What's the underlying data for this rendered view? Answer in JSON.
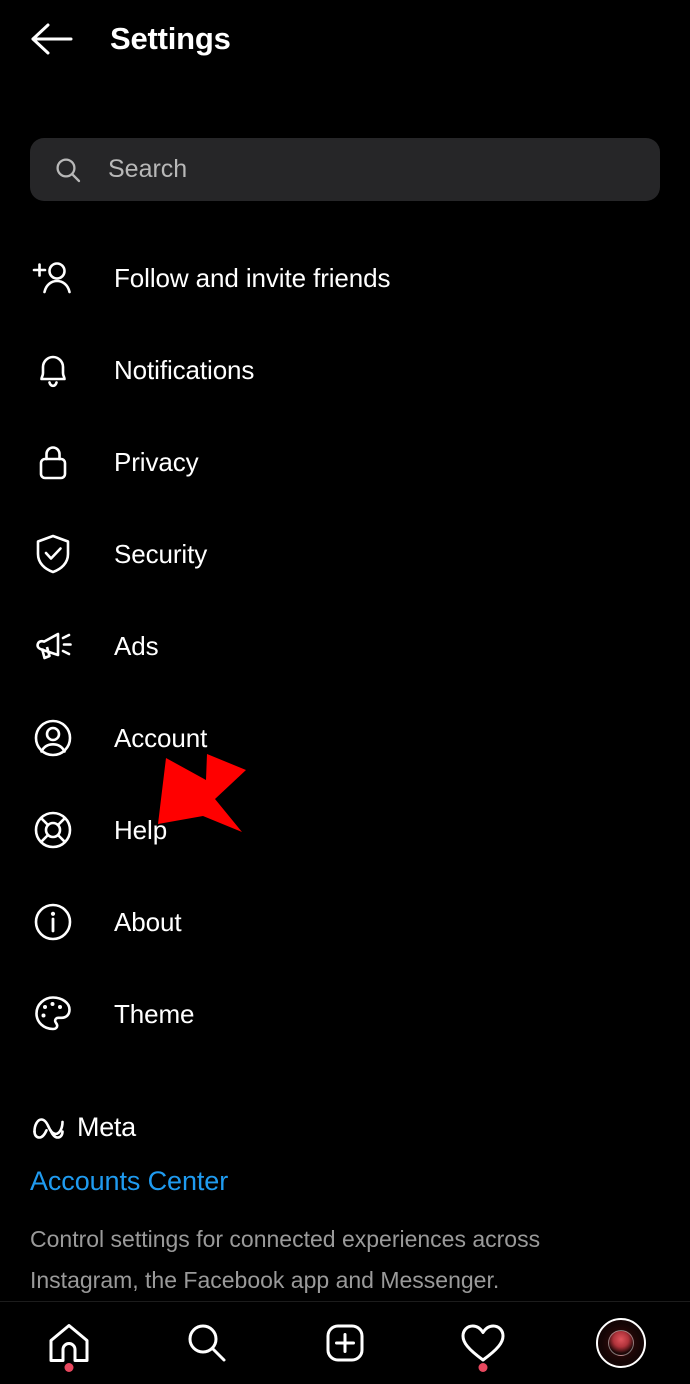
{
  "header": {
    "back_icon": "arrow-left-icon",
    "title": "Settings"
  },
  "search": {
    "icon": "search-icon",
    "placeholder": "Search",
    "value": ""
  },
  "menu": {
    "items": [
      {
        "icon": "person-add-icon",
        "label": "Follow and invite friends"
      },
      {
        "icon": "bell-icon",
        "label": "Notifications"
      },
      {
        "icon": "lock-icon",
        "label": "Privacy"
      },
      {
        "icon": "shield-check-icon",
        "label": "Security"
      },
      {
        "icon": "megaphone-icon",
        "label": "Ads"
      },
      {
        "icon": "account-circle-icon",
        "label": "Account"
      },
      {
        "icon": "life-ring-icon",
        "label": "Help"
      },
      {
        "icon": "info-circle-icon",
        "label": "About"
      },
      {
        "icon": "palette-icon",
        "label": "Theme"
      }
    ]
  },
  "meta": {
    "logo_icon": "meta-infinity-icon",
    "brand": "Meta",
    "accounts_center_link": "Accounts Center",
    "description": "Control settings for connected experiences across Instagram, the Facebook app and Messenger."
  },
  "annotation": {
    "arrow_icon": "red-arrow-icon",
    "arrow_color": "#FF0000",
    "points_at": "Help"
  },
  "bottom_nav": {
    "items": [
      {
        "icon": "home-icon",
        "badge": true
      },
      {
        "icon": "search-icon",
        "badge": false
      },
      {
        "icon": "plus-box-icon",
        "badge": false
      },
      {
        "icon": "heart-icon",
        "badge": true
      },
      {
        "icon": "avatar-icon",
        "badge": false
      }
    ],
    "badge_color": "#E8485F"
  },
  "colors": {
    "background": "#000000",
    "search_field": "#262628",
    "link_blue": "#1F9BF0",
    "secondary_text": "#9A9A9A",
    "primary_text": "#FFFFFF"
  }
}
